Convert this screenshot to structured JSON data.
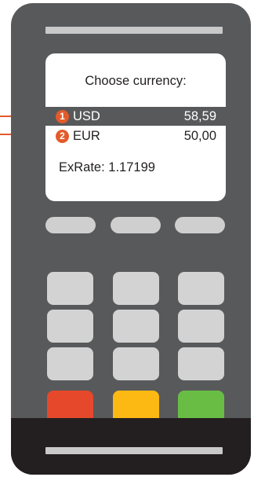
{
  "screen": {
    "title": "Choose currency:",
    "options": [
      {
        "number": "1",
        "currency": "USD",
        "amount": "58,59",
        "selected": true
      },
      {
        "number": "2",
        "currency": "EUR",
        "amount": "50,00",
        "selected": false
      }
    ],
    "exchange_rate": "ExRate: 1.17199"
  },
  "colors": {
    "terminal_body": "#58595b",
    "terminal_base": "#231f20",
    "highlight": "#e35b2a",
    "cancel_key": "#e5482a",
    "clear_key": "#fdb913",
    "ok_key": "#69bd45"
  }
}
